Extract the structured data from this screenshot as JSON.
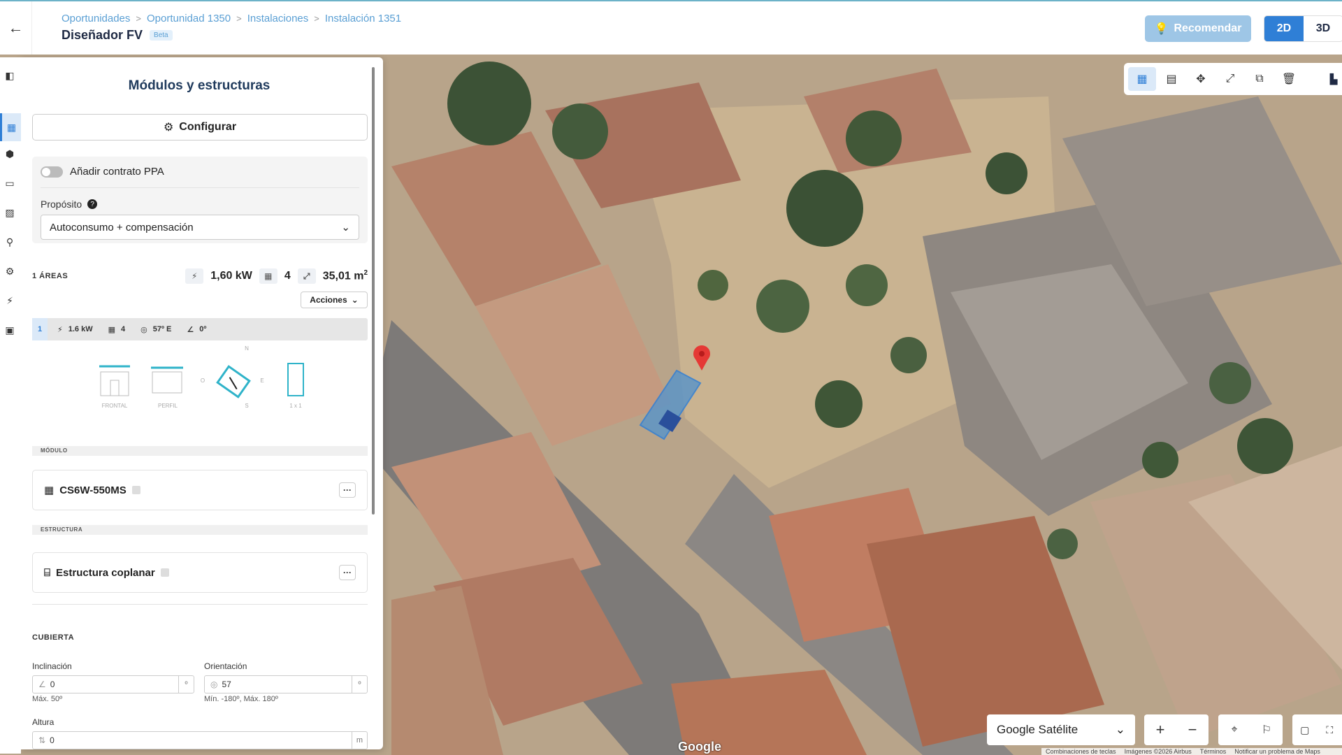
{
  "header": {
    "back_icon": "arrow-left-icon",
    "breadcrumbs": [
      "Oportunidades",
      "Oportunidad 1350",
      "Instalaciones",
      "Instalación 1351"
    ],
    "title": "Diseñador FV",
    "badge": "Beta",
    "recommend_label": "Recomendar",
    "view_2d": "2D",
    "view_3d": "3D",
    "accent_color": "#2f7fd6"
  },
  "panel": {
    "title": "Módulos y estructuras",
    "configure_label": "Configurar",
    "ppa_label": "Añadir contrato PPA",
    "ppa_enabled": false,
    "purpose_label": "Propósito",
    "purpose_value": "Autoconsumo + compensación",
    "areas_label": "1 ÁREAS",
    "total_power": "1,60 kW",
    "total_modules": "4",
    "total_area": "35,01 m",
    "area_sup": "2",
    "actions_label": "Acciones",
    "area_row": {
      "index": "1",
      "power": "1.6 kW",
      "modules": "4",
      "orientation": "57º E",
      "tilt": "0º"
    },
    "diagram": {
      "frontal": "FRONTAL",
      "perfil": "PERFIL",
      "n": "N",
      "s": "S",
      "e": "E",
      "o": "O",
      "layout": "1 x 1"
    },
    "module_section": "MÓDULO",
    "module_name": "CS6W-550MS",
    "structure_section": "ESTRUCTURA",
    "structure_name": "Estructura coplanar",
    "more_label": "···",
    "roof_section": "CUBIERTA",
    "inclination_label": "Inclinación",
    "inclination_value": "0",
    "inclination_unit": "º",
    "inclination_hint": "Máx. 50º",
    "orientation_label": "Orientación",
    "orientation_value": "57",
    "orientation_unit": "º",
    "orientation_hint": "Mín. -180º, Máx. 180º",
    "height_label": "Altura",
    "height_value": "0",
    "height_unit": "m"
  },
  "map": {
    "map_type": "Google Satélite",
    "zoom_in": "+",
    "zoom_out": "−",
    "google_logo": "Google",
    "attribution": [
      "Combinaciones de teclas",
      "Imágenes ©2026 Airbus",
      "Términos",
      "Notificar un problema de Maps"
    ]
  }
}
